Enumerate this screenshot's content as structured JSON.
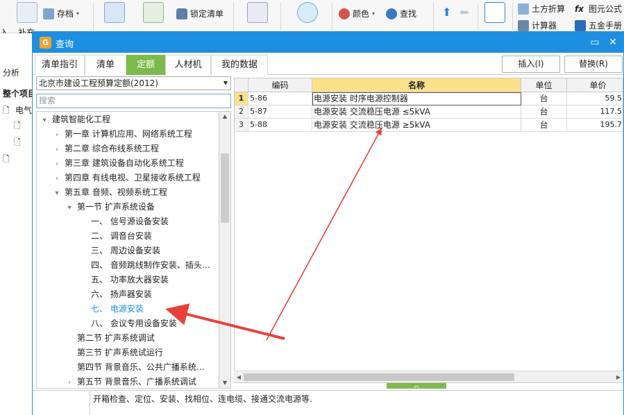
{
  "ribbon": {
    "buttons": [
      {
        "name": "save-button",
        "label": "存档"
      },
      {
        "name": "lock-list-button",
        "label": "锁定清单"
      },
      {
        "name": "color-button",
        "label": "颜色"
      },
      {
        "name": "find-button",
        "label": "查找"
      },
      {
        "name": "earthwork-button",
        "label": "土方折算"
      },
      {
        "name": "element-formula-button",
        "label": "图元公式"
      },
      {
        "name": "calculator-button",
        "label": "计算器"
      },
      {
        "name": "hardware-manual-button",
        "label": "五金手册"
      }
    ],
    "partial_left_label": "入",
    "supplement_label": "补充"
  },
  "left_pane": {
    "analysis_label": "分析",
    "project_label": "整个项目",
    "item_label": "电气"
  },
  "dialog": {
    "title": "查询",
    "tabs": [
      {
        "label": "清单指引",
        "active": false
      },
      {
        "label": "清单",
        "active": false
      },
      {
        "label": "定额",
        "active": true
      },
      {
        "label": "人材机",
        "active": false
      },
      {
        "label": "我的数据",
        "active": false
      }
    ],
    "insert_button": "插入(I)",
    "replace_button": "替换(R)",
    "quota_library": "北京市建设工程预算定额(2012)",
    "search_placeholder": "搜索",
    "tree": [
      {
        "label": "建筑智能化工程",
        "level": 0,
        "twisty": "▾"
      },
      {
        "label": "第一章  计算机应用、网络系统工程",
        "level": 1,
        "twisty": "›"
      },
      {
        "label": "第二章  综合布线系统工程",
        "level": 1,
        "twisty": "›"
      },
      {
        "label": "第三章  建筑设备自动化系统工程",
        "level": 1,
        "twisty": "›"
      },
      {
        "label": "第四章  有线电视、卫星接收系统工程",
        "level": 1,
        "twisty": "›"
      },
      {
        "label": "第五章  音频、视频系统工程",
        "level": 1,
        "twisty": "▾"
      },
      {
        "label": "第一节  扩声系统设备",
        "level": 2,
        "twisty": "▾"
      },
      {
        "label": "一、  信号源设备安装",
        "level": 3,
        "twisty": ""
      },
      {
        "label": "二、  调音台安装",
        "level": 3,
        "twisty": ""
      },
      {
        "label": "三、  周边设备安装",
        "level": 3,
        "twisty": ""
      },
      {
        "label": "四、  音频跳线制作安装、插头…",
        "level": 3,
        "twisty": ""
      },
      {
        "label": "五、  功率放大器安装",
        "level": 3,
        "twisty": ""
      },
      {
        "label": "六、  扬声器安装",
        "level": 3,
        "twisty": ""
      },
      {
        "label": "七、  电源安装",
        "level": 3,
        "twisty": "",
        "selected": true
      },
      {
        "label": "八、  会议专用设备安装",
        "level": 3,
        "twisty": ""
      },
      {
        "label": "第二节  扩声系统调试",
        "level": 2,
        "twisty": ""
      },
      {
        "label": "第三节  扩声系统试运行",
        "level": 2,
        "twisty": ""
      },
      {
        "label": "第四节  背景音乐、公共广播系统…",
        "level": 2,
        "twisty": ""
      },
      {
        "label": "第五节  背景音乐、广播系统调试",
        "level": 2,
        "twisty": "›"
      }
    ],
    "grid": {
      "headers": [
        "编码",
        "名称",
        "单位",
        "单价"
      ],
      "rows": [
        {
          "no": "1",
          "code": "5-86",
          "name": "电源安装 时序电源控制器",
          "unit": "台",
          "price": "59.5"
        },
        {
          "no": "2",
          "code": "5-87",
          "name": "电源安装 交流稳压电源 ≤5kVA",
          "unit": "台",
          "price": "117.5"
        },
        {
          "no": "3",
          "code": "5-88",
          "name": "电源安装 交流稳压电源 ≥5kVA",
          "unit": "台",
          "price": "195.7"
        }
      ]
    },
    "description": "开箱检查、定位、安装、找相位、连电缆、接通交流电源等."
  },
  "colors": {
    "titlebar": "#1e8fe0",
    "active_tab": "#7dba4c",
    "annotation_arrow": "#e8413a",
    "highlight_header": "#fce08a"
  }
}
